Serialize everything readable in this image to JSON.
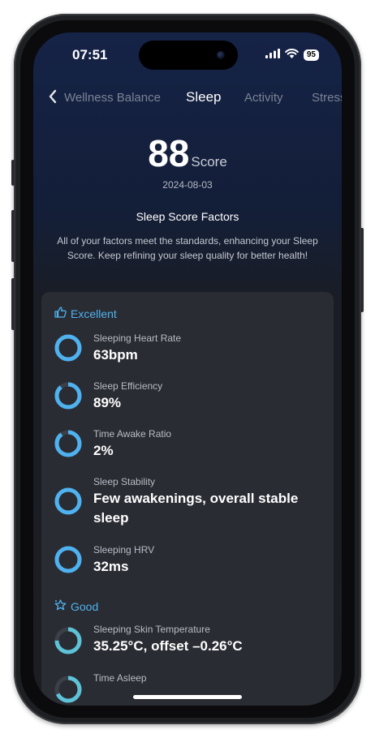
{
  "status_bar": {
    "time": "07:51",
    "battery": "95"
  },
  "nav": {
    "tabs": [
      {
        "label": "Wellness Balance"
      },
      {
        "label": "Sleep"
      },
      {
        "label": "Activity"
      },
      {
        "label": "Stress"
      }
    ],
    "active_tab": "Sleep"
  },
  "score": {
    "value": "88",
    "label": "Score",
    "date": "2024-08-03"
  },
  "factors": {
    "title": "Sleep Score Factors",
    "summary": "All of your factors meet the standards, enhancing your Sleep Score. Keep refining your sleep quality for better health!"
  },
  "sections": {
    "excellent": {
      "label": "Excellent",
      "items": [
        {
          "label": "Sleeping Heart Rate",
          "value": "63bpm",
          "fill": 1.0
        },
        {
          "label": "Sleep Efficiency",
          "value": "89%",
          "fill": 0.89
        },
        {
          "label": "Time Awake Ratio",
          "value": "2%",
          "fill": 0.9
        },
        {
          "label": "Sleep Stability",
          "value": "Few awakenings, overall stable sleep",
          "fill": 1.0
        },
        {
          "label": "Sleeping HRV",
          "value": "32ms",
          "fill": 1.0
        }
      ]
    },
    "good": {
      "label": "Good",
      "items": [
        {
          "label": "Sleeping Skin Temperature",
          "value": "35.25°C, offset –0.26°C",
          "fill": 0.75
        },
        {
          "label": "Time Asleep",
          "value": ""
        }
      ]
    }
  },
  "colors": {
    "accent": "#4fb2f0",
    "ring_good": "#5ec2d8",
    "ring_track": "#3a3f4a"
  }
}
